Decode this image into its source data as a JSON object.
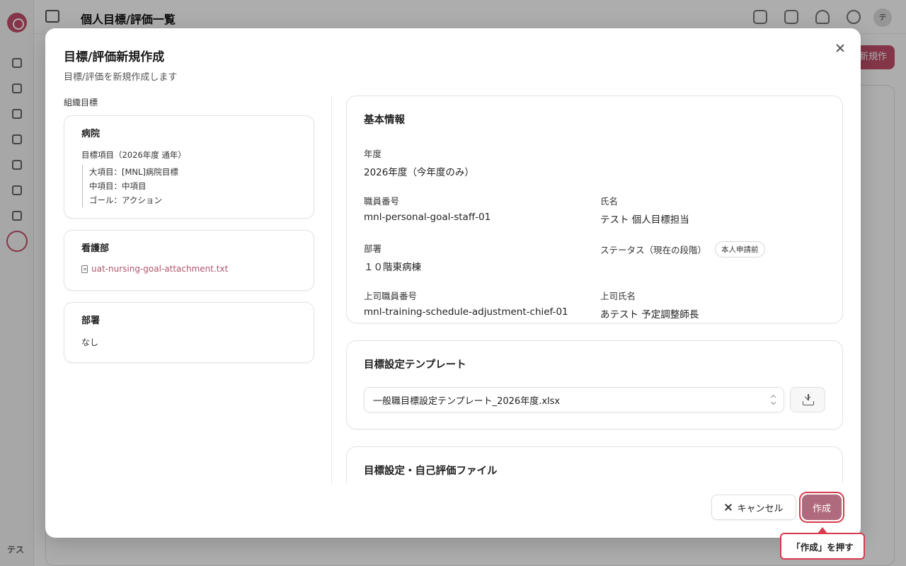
{
  "app": {
    "page_title": "個人目標/評価一覧",
    "create_button": "新規作成",
    "user_initials": "テス",
    "avatar_initial": "テ"
  },
  "modal": {
    "title": "目標/評価新規作成",
    "description": "目標/評価を新規作成します",
    "org_goals": {
      "heading": "組織目標",
      "hospital": {
        "title": "病院",
        "item_header": "目標項目（2026年度 通年）",
        "major": "大項目：[MNL]病院目標",
        "middle": "中項目：中項目",
        "goal": "ゴール：アクション"
      },
      "nursing": {
        "title": "看護部",
        "attachment": "uat-nursing-goal-attachment.txt"
      },
      "department": {
        "title": "部署",
        "value": "なし"
      }
    },
    "basic_info": {
      "title": "基本情報",
      "year_label": "年度",
      "year_value": "2026年度（今年度のみ）",
      "staff_no_label": "職員番号",
      "staff_no_value": "mnl-personal-goal-staff-01",
      "name_label": "氏名",
      "name_value": "テスト 個人目標担当",
      "dept_label": "部署",
      "dept_value": "１０階東病棟",
      "status_label": "ステータス（現在の段階）",
      "status_badge": "本人申請前",
      "boss_no_label": "上司職員番号",
      "boss_no_value": "mnl-training-schedule-adjustment-chief-01",
      "boss_name_label": "上司氏名",
      "boss_name_value": "あテスト 予定調整師長"
    },
    "template": {
      "title": "目標設定テンプレート",
      "selected": "一般職目標設定テンプレート_2026年度.xlsx"
    },
    "self_eval": {
      "title": "目標設定・自己評価ファイル"
    },
    "footer": {
      "cancel": "キャンセル",
      "create": "作成"
    }
  },
  "tooltip": "「作成」を押す",
  "colors": {
    "accent": "#c3506a",
    "highlight_border": "#d93b4d",
    "create_button_bg": "#b06a7d"
  }
}
